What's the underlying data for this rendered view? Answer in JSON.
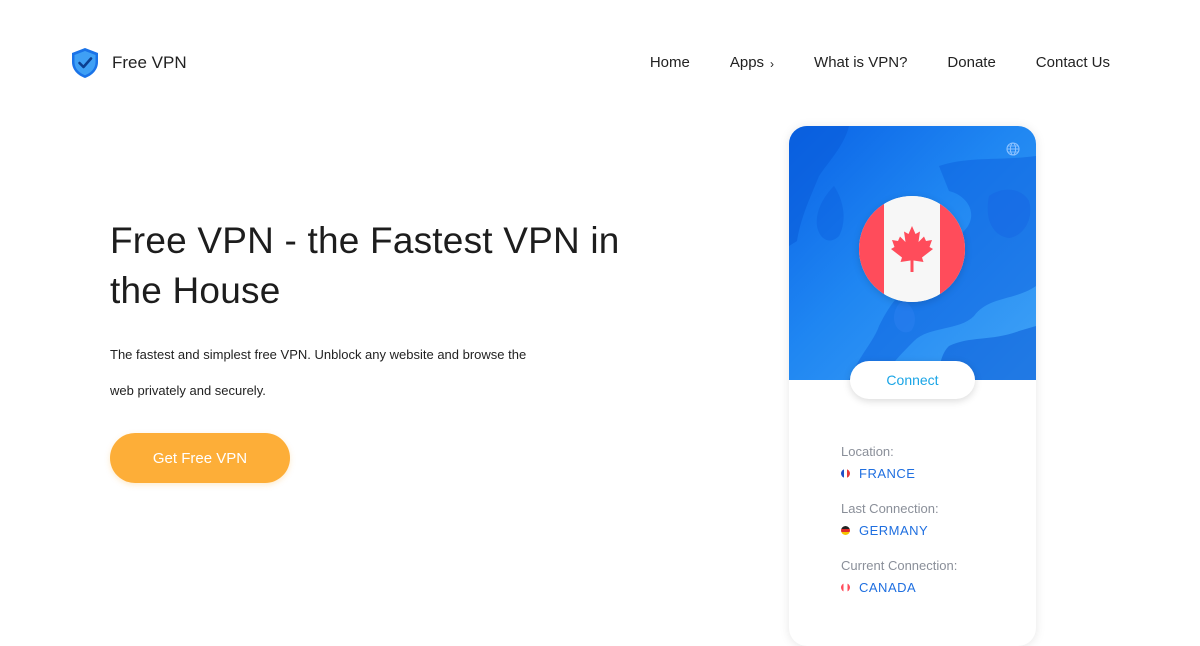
{
  "brand": {
    "name": "Free VPN",
    "logo_icon": "shield-check-icon"
  },
  "nav": {
    "items": [
      {
        "label": "Home"
      },
      {
        "label": "Apps",
        "has_submenu": true
      },
      {
        "label": "What is VPN?"
      },
      {
        "label": "Donate"
      },
      {
        "label": "Contact Us"
      }
    ],
    "submenu_icon": "chevron-right-icon"
  },
  "hero": {
    "title": "Free VPN - the Fastest VPN in the House",
    "description": "The fastest and simplest free VPN. Unblock any website and browse the web privately and securely.",
    "cta_label": "Get Free VPN"
  },
  "app_preview": {
    "selected_flag": "canada-flag-icon",
    "globe_icon": "globe-icon",
    "connect_label": "Connect",
    "location_label": "Location:",
    "location_value": "FRANCE",
    "last_connection_label": "Last Connection:",
    "last_connection_value": "GERMANY",
    "current_connection_label": "Current Connection:",
    "current_connection_value": "CANADA"
  },
  "colors": {
    "accent_orange": "#fdae38",
    "map_blue": "#1f86f2",
    "connect_text": "#1aa5e6",
    "country_text": "#1f6fe0"
  }
}
